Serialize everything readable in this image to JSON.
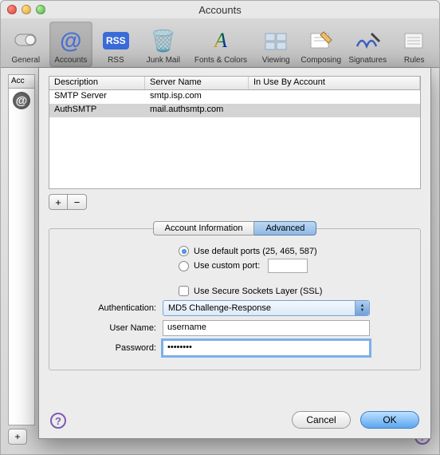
{
  "window": {
    "title": "Accounts"
  },
  "toolbar": {
    "items": [
      {
        "label": "General"
      },
      {
        "label": "Accounts"
      },
      {
        "label": "RSS"
      },
      {
        "label": "Junk Mail"
      },
      {
        "label": "Fonts & Colors"
      },
      {
        "label": "Viewing"
      },
      {
        "label": "Composing"
      },
      {
        "label": "Signatures"
      },
      {
        "label": "Rules"
      }
    ]
  },
  "sidebar": {
    "header": "Acc"
  },
  "sheet": {
    "table": {
      "headers": {
        "desc": "Description",
        "server": "Server Name",
        "inuse": "In Use By Account"
      },
      "rows": [
        {
          "desc": "SMTP Server",
          "server": "smtp.isp.com",
          "inuse": ""
        },
        {
          "desc": "AuthSMTP",
          "server": "mail.authsmtp.com",
          "inuse": ""
        }
      ]
    },
    "tabs": {
      "info": "Account Information",
      "advanced": "Advanced"
    },
    "form": {
      "default_ports": "Use default ports (25, 465, 587)",
      "custom_port": "Use custom port:",
      "ssl": "Use Secure Sockets Layer (SSL)",
      "auth_label": "Authentication:",
      "auth_value": "MD5 Challenge-Response",
      "user_label": "User Name:",
      "user_value": "username",
      "pass_label": "Password:",
      "pass_value": "••••••••"
    },
    "buttons": {
      "cancel": "Cancel",
      "ok": "OK"
    }
  }
}
